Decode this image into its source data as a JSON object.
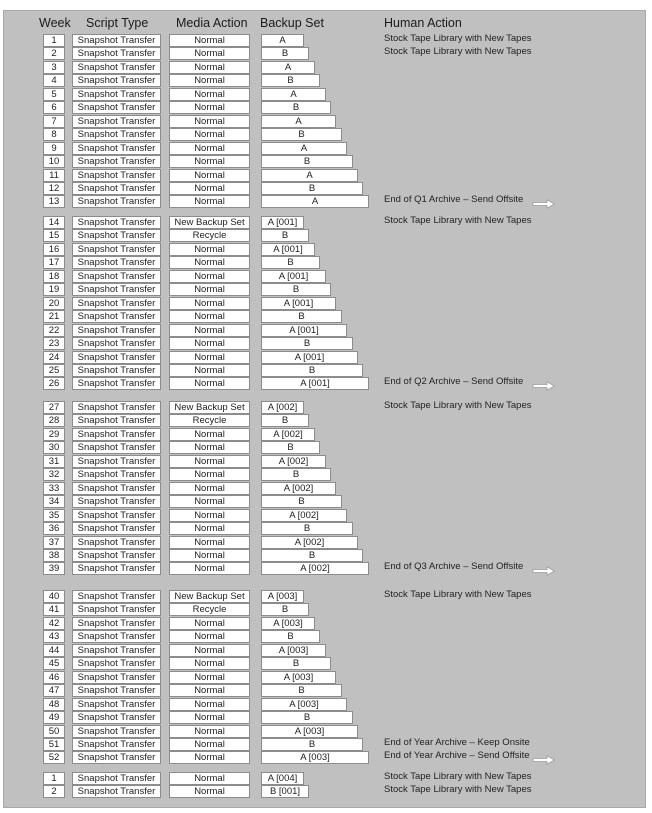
{
  "headers": {
    "week": "Week",
    "script_type": "Script Type",
    "media_action": "Media Action",
    "backup_set": "Backup Set",
    "human_action": "Human Action"
  },
  "arrow_icon": "right-arrow-icon",
  "groups": [
    {
      "rows": [
        {
          "week": "1",
          "script": "Snapshot Transfer",
          "media": "Normal",
          "backup": "A",
          "human": "Stock Tape Library with New Tapes",
          "arrow": false
        },
        {
          "week": "2",
          "script": "Snapshot Transfer",
          "media": "Normal",
          "backup": "B",
          "human": "Stock Tape Library with New Tapes",
          "arrow": false
        },
        {
          "week": "3",
          "script": "Snapshot Transfer",
          "media": "Normal",
          "backup": "A",
          "human": "",
          "arrow": false
        },
        {
          "week": "4",
          "script": "Snapshot Transfer",
          "media": "Normal",
          "backup": "B",
          "human": "",
          "arrow": false
        },
        {
          "week": "5",
          "script": "Snapshot Transfer",
          "media": "Normal",
          "backup": "A",
          "human": "",
          "arrow": false
        },
        {
          "week": "6",
          "script": "Snapshot Transfer",
          "media": "Normal",
          "backup": "B",
          "human": "",
          "arrow": false
        },
        {
          "week": "7",
          "script": "Snapshot Transfer",
          "media": "Normal",
          "backup": "A",
          "human": "",
          "arrow": false
        },
        {
          "week": "8",
          "script": "Snapshot Transfer",
          "media": "Normal",
          "backup": "B",
          "human": "",
          "arrow": false
        },
        {
          "week": "9",
          "script": "Snapshot Transfer",
          "media": "Normal",
          "backup": "A",
          "human": "",
          "arrow": false
        },
        {
          "week": "10",
          "script": "Snapshot Transfer",
          "media": "Normal",
          "backup": "B",
          "human": "",
          "arrow": false
        },
        {
          "week": "11",
          "script": "Snapshot Transfer",
          "media": "Normal",
          "backup": "A",
          "human": "",
          "arrow": false
        },
        {
          "week": "12",
          "script": "Snapshot Transfer",
          "media": "Normal",
          "backup": "B",
          "human": "",
          "arrow": false
        },
        {
          "week": "13",
          "script": "Snapshot Transfer",
          "media": "Normal",
          "backup": "A",
          "human": "End of Q1 Archive – Send Offsite",
          "arrow": true
        }
      ]
    },
    {
      "rows": [
        {
          "week": "14",
          "script": "Snapshot Transfer",
          "media": "New Backup Set",
          "backup": "A [001]",
          "human": "Stock Tape Library with New Tapes",
          "arrow": false
        },
        {
          "week": "15",
          "script": "Snapshot Transfer",
          "media": "Recycle",
          "backup": "B",
          "human": "",
          "arrow": false
        },
        {
          "week": "16",
          "script": "Snapshot Transfer",
          "media": "Normal",
          "backup": "A [001]",
          "human": "",
          "arrow": false
        },
        {
          "week": "17",
          "script": "Snapshot Transfer",
          "media": "Normal",
          "backup": "B",
          "human": "",
          "arrow": false
        },
        {
          "week": "18",
          "script": "Snapshot Transfer",
          "media": "Normal",
          "backup": "A [001]",
          "human": "",
          "arrow": false
        },
        {
          "week": "19",
          "script": "Snapshot Transfer",
          "media": "Normal",
          "backup": "B",
          "human": "",
          "arrow": false
        },
        {
          "week": "20",
          "script": "Snapshot Transfer",
          "media": "Normal",
          "backup": "A [001]",
          "human": "",
          "arrow": false
        },
        {
          "week": "21",
          "script": "Snapshot Transfer",
          "media": "Normal",
          "backup": "B",
          "human": "",
          "arrow": false
        },
        {
          "week": "22",
          "script": "Snapshot Transfer",
          "media": "Normal",
          "backup": "A [001]",
          "human": "",
          "arrow": false
        },
        {
          "week": "23",
          "script": "Snapshot Transfer",
          "media": "Normal",
          "backup": "B",
          "human": "",
          "arrow": false
        },
        {
          "week": "24",
          "script": "Snapshot Transfer",
          "media": "Normal",
          "backup": "A [001]",
          "human": "",
          "arrow": false
        },
        {
          "week": "25",
          "script": "Snapshot Transfer",
          "media": "Normal",
          "backup": "B",
          "human": "",
          "arrow": false
        },
        {
          "week": "26",
          "script": "Snapshot Transfer",
          "media": "Normal",
          "backup": "A [001]",
          "human": "End of Q2 Archive – Send Offsite",
          "arrow": true
        }
      ]
    },
    {
      "rows": [
        {
          "week": "27",
          "script": "Snapshot Transfer",
          "media": "New Backup Set",
          "backup": "A [002]",
          "human": "Stock Tape Library with New Tapes",
          "arrow": false
        },
        {
          "week": "28",
          "script": "Snapshot Transfer",
          "media": "Recycle",
          "backup": "B",
          "human": "",
          "arrow": false
        },
        {
          "week": "29",
          "script": "Snapshot Transfer",
          "media": "Normal",
          "backup": "A [002]",
          "human": "",
          "arrow": false
        },
        {
          "week": "30",
          "script": "Snapshot Transfer",
          "media": "Normal",
          "backup": "B",
          "human": "",
          "arrow": false
        },
        {
          "week": "31",
          "script": "Snapshot Transfer",
          "media": "Normal",
          "backup": "A [002]",
          "human": "",
          "arrow": false
        },
        {
          "week": "32",
          "script": "Snapshot Transfer",
          "media": "Normal",
          "backup": "B",
          "human": "",
          "arrow": false
        },
        {
          "week": "33",
          "script": "Snapshot Transfer",
          "media": "Normal",
          "backup": "A [002]",
          "human": "",
          "arrow": false
        },
        {
          "week": "34",
          "script": "Snapshot Transfer",
          "media": "Normal",
          "backup": "B",
          "human": "",
          "arrow": false
        },
        {
          "week": "35",
          "script": "Snapshot Transfer",
          "media": "Normal",
          "backup": "A [002]",
          "human": "",
          "arrow": false
        },
        {
          "week": "36",
          "script": "Snapshot Transfer",
          "media": "Normal",
          "backup": "B",
          "human": "",
          "arrow": false
        },
        {
          "week": "37",
          "script": "Snapshot Transfer",
          "media": "Normal",
          "backup": "A [002]",
          "human": "",
          "arrow": false
        },
        {
          "week": "38",
          "script": "Snapshot Transfer",
          "media": "Normal",
          "backup": "B",
          "human": "",
          "arrow": false
        },
        {
          "week": "39",
          "script": "Snapshot Transfer",
          "media": "Normal",
          "backup": "A [002]",
          "human": "End of Q3 Archive – Send Offsite",
          "arrow": true
        }
      ]
    },
    {
      "rows": [
        {
          "week": "40",
          "script": "Snapshot Transfer",
          "media": "New Backup Set",
          "backup": "A [003]",
          "human": "Stock Tape Library with New Tapes",
          "arrow": false
        },
        {
          "week": "41",
          "script": "Snapshot Transfer",
          "media": "Recycle",
          "backup": "B",
          "human": "",
          "arrow": false
        },
        {
          "week": "42",
          "script": "Snapshot Transfer",
          "media": "Normal",
          "backup": "A [003]",
          "human": "",
          "arrow": false
        },
        {
          "week": "43",
          "script": "Snapshot Transfer",
          "media": "Normal",
          "backup": "B",
          "human": "",
          "arrow": false
        },
        {
          "week": "44",
          "script": "Snapshot Transfer",
          "media": "Normal",
          "backup": "A [003]",
          "human": "",
          "arrow": false
        },
        {
          "week": "45",
          "script": "Snapshot Transfer",
          "media": "Normal",
          "backup": "B",
          "human": "",
          "arrow": false
        },
        {
          "week": "46",
          "script": "Snapshot Transfer",
          "media": "Normal",
          "backup": "A [003]",
          "human": "",
          "arrow": false
        },
        {
          "week": "47",
          "script": "Snapshot Transfer",
          "media": "Normal",
          "backup": "B",
          "human": "",
          "arrow": false
        },
        {
          "week": "48",
          "script": "Snapshot Transfer",
          "media": "Normal",
          "backup": "A [003]",
          "human": "",
          "arrow": false
        },
        {
          "week": "49",
          "script": "Snapshot Transfer",
          "media": "Normal",
          "backup": "B",
          "human": "",
          "arrow": false
        },
        {
          "week": "50",
          "script": "Snapshot Transfer",
          "media": "Normal",
          "backup": "A [003]",
          "human": "",
          "arrow": false
        },
        {
          "week": "51",
          "script": "Snapshot Transfer",
          "media": "Normal",
          "backup": "B",
          "human": "End of Year Archive – Keep Onsite",
          "arrow": false
        },
        {
          "week": "52",
          "script": "Snapshot Transfer",
          "media": "Normal",
          "backup": "A [003]",
          "human": "End of Year Archive – Send Offsite",
          "arrow": true
        }
      ]
    },
    {
      "rows": [
        {
          "week": "1",
          "script": "Snapshot Transfer",
          "media": "Normal",
          "backup": "A [004]",
          "human": "Stock Tape Library with New Tapes",
          "arrow": false
        },
        {
          "week": "2",
          "script": "Snapshot Transfer",
          "media": "Normal",
          "backup": "B [001]",
          "human": "Stock Tape Library with New Tapes",
          "arrow": false
        }
      ]
    }
  ]
}
